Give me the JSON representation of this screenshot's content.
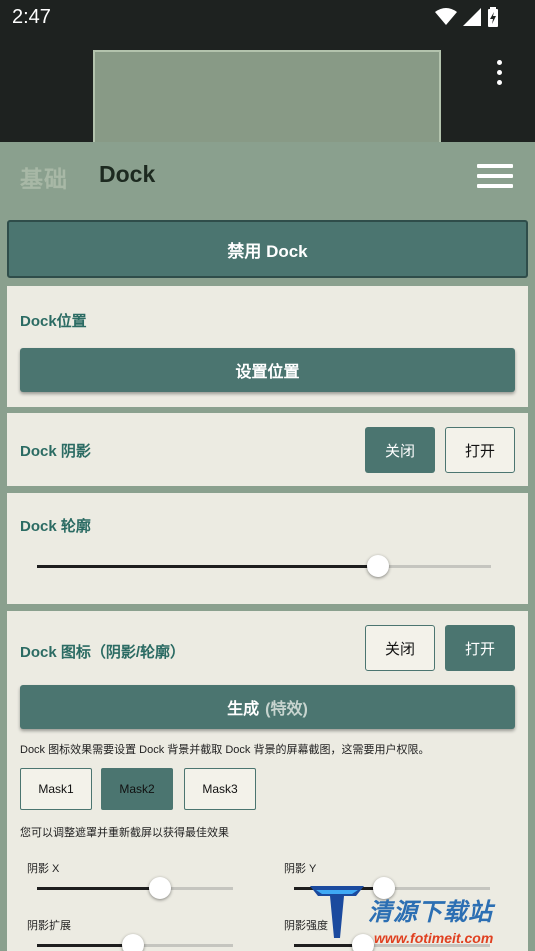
{
  "status_bar": {
    "time": "2:47",
    "wifi_icon": "wifi-icon",
    "signal_icon": "signal-icon",
    "battery_icon": "battery-charging-icon"
  },
  "top": {
    "menu_icon": "more-vert-icon"
  },
  "header": {
    "tab_basic": "基础",
    "tab_dock": "Dock",
    "menu_icon": "hamburger-menu-icon"
  },
  "primary_button": {
    "label": "禁用 Dock"
  },
  "position_card": {
    "title": "Dock位置",
    "button": "设置位置"
  },
  "shadow_card": {
    "title": "Dock 阴影",
    "off": "关闭",
    "on": "打开",
    "selected": "关闭"
  },
  "outline_card": {
    "title": "Dock 轮廓",
    "slider_value": 0.75
  },
  "icon_card": {
    "title": "Dock 图标（阴影/轮廓）",
    "off": "关闭",
    "on": "打开",
    "selected": "打开",
    "generate_label": "生成",
    "generate_hint": "(特效)",
    "note": "Dock 图标效果需要设置 Dock 背景并截取 Dock 背景的屏幕截图，这需要用户权限。",
    "masks": [
      "Mask1",
      "Mask2",
      "Mask3"
    ],
    "selected_mask": "Mask2",
    "adjust_note": "您可以调整遮罩并重新截屏以获得最佳效果",
    "shadow_x_label": "阴影 X",
    "shadow_x_value": 0.63,
    "shadow_y_label": "阴影 Y",
    "shadow_y_value": 0.46,
    "shadow_spread_label": "阴影扩展",
    "shadow_spread_value": 0.49,
    "shadow_strength_label": "阴影强度",
    "shadow_strength_value": 0.35
  },
  "watermark": {
    "title": "清源下载站",
    "url": "www.fotimeit.com"
  },
  "colors": {
    "accent": "#4b7570",
    "label": "#2b6b63",
    "card": "#ecebe2",
    "background": "#8aa08e"
  }
}
